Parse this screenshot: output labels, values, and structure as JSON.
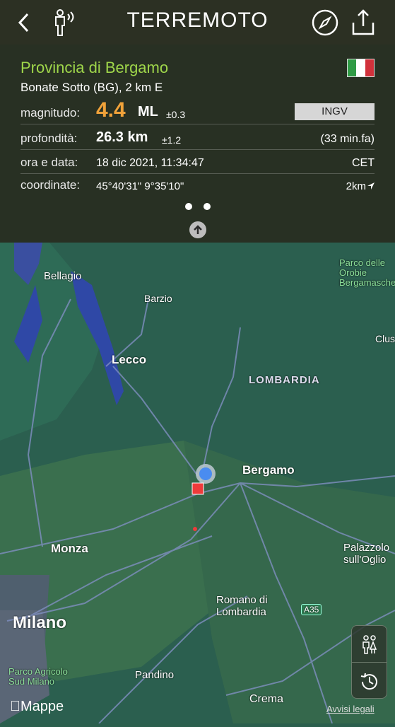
{
  "header": {
    "title": "TERREMOTO",
    "back_icon": "chevron-left-icon",
    "person_icon": "person-signal-icon",
    "compass_icon": "compass-icon",
    "share_icon": "share-icon"
  },
  "event": {
    "region": "Provincia di Bergamo",
    "locality": "Bonate Sotto (BG), 2 km E",
    "magnitude_label": "magnitudo:",
    "magnitude_value": "4.4",
    "magnitude_unit": "ML",
    "magnitude_err": "±0.3",
    "agency": "INGV",
    "depth_label": "profondità:",
    "depth_value": "26.3 km",
    "depth_err": "±1.2",
    "ago": "(33 min.fa)",
    "time_label": "ora e data:",
    "time_value": "18 dic 2021, 11:34:47",
    "timezone": "CET",
    "coord_label": "coordinate:",
    "coord_value": "45°40'31\"  9°35'10\"",
    "distance": "2km"
  },
  "flag_colors": [
    "#2f9a45",
    "#ffffff",
    "#d1313b"
  ],
  "map": {
    "labels": {
      "bellagio": "Bellagio",
      "barzio": "Barzio",
      "lecco": "Lecco",
      "lombardia": "LOMBARDIA",
      "bergamo": "Bergamo",
      "monza": "Monza",
      "milano": "Milano",
      "palazzolo": "Palazzolo sull'Oglio",
      "romano": "Romano di Lombardia",
      "pandino": "Pandino",
      "crema": "Crema",
      "orobie": "Parco delle Orobie Bergamasche",
      "agricolo": "Parco Agricolo Sud Milano",
      "clus": "Clus",
      "a35": "A35"
    },
    "attribution": "Mappe",
    "legal": "Avvisi legali"
  }
}
